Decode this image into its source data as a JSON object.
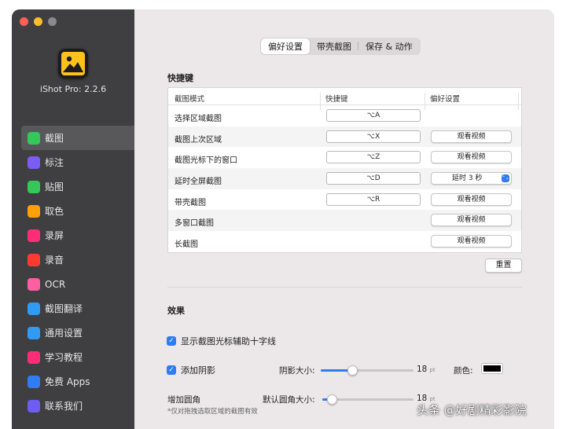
{
  "app": {
    "version": "iShot Pro: 2.2.6"
  },
  "sidebar": {
    "items": [
      {
        "label": "截图",
        "icon": "screenshot-icon",
        "color": "#34c759",
        "active": true
      },
      {
        "label": "标注",
        "icon": "cursor-icon",
        "color": "#7b5cf5"
      },
      {
        "label": "贴图",
        "icon": "pin-icon",
        "color": "#34c759"
      },
      {
        "label": "取色",
        "icon": "eyedropper-icon",
        "color": "#ff9f0a"
      },
      {
        "label": "录屏",
        "icon": "screen-record-icon",
        "color": "#ff2d78"
      },
      {
        "label": "录音",
        "icon": "microphone-icon",
        "color": "#ff3b30"
      },
      {
        "label": "OCR",
        "icon": "ocr-icon",
        "color": "#ff5fa2"
      },
      {
        "label": "截图翻译",
        "icon": "translate-icon",
        "color": "#2f9bf5"
      },
      {
        "label": "通用设置",
        "icon": "gear-icon",
        "color": "#2f9bf5"
      },
      {
        "label": "学习教程",
        "icon": "play-icon",
        "color": "#ff2d78"
      },
      {
        "label": "免费 Apps",
        "icon": "app-store-icon",
        "color": "#2f7cf6"
      },
      {
        "label": "联系我们",
        "icon": "contact-icon",
        "color": "#6e5cf5"
      }
    ]
  },
  "tabs": [
    {
      "label": "偏好设置",
      "active": true
    },
    {
      "label": "带壳截图"
    },
    {
      "label": "保存 & 动作"
    }
  ],
  "shortcuts": {
    "title": "快捷键",
    "headers": [
      "截图模式",
      "快捷键",
      "偏好设置"
    ],
    "rows": [
      {
        "mode": "选择区域截图",
        "key": "⌥A",
        "pref": ""
      },
      {
        "mode": "截图上次区域",
        "key": "⌥X",
        "pref": "观看视频"
      },
      {
        "mode": "截图光标下的窗口",
        "key": "⌥Z",
        "pref": "观看视频"
      },
      {
        "mode": "延时全屏截图",
        "key": "⌥D",
        "pref": "延时 3 秒",
        "select": true
      },
      {
        "mode": "带壳截图",
        "key": "⌥R",
        "pref": "观看视频"
      },
      {
        "mode": "多窗口截图",
        "key": "",
        "pref": "观看视频"
      },
      {
        "mode": "长截图",
        "key": "",
        "pref": "观看视频"
      }
    ],
    "reset_label": "重置"
  },
  "effects": {
    "title": "效果",
    "crosshair_label": "显示截图光标辅助十字线",
    "shadow_label": "添加阴影",
    "shadow_size_label": "阴影大小:",
    "shadow_size_value": "18",
    "shadow_size_fraction": 0.34,
    "unit": "pt",
    "color_label": "颜色:",
    "shadow_color": "#000000",
    "corner_label": "增加圆角",
    "corner_size_label": "默认圆角大小:",
    "corner_size_value": "18",
    "corner_size_fraction": 0.1,
    "corner_note": "*仅对拖拽选取区域的截图有效"
  },
  "watermark": "头条 @好剧精彩影院",
  "colors": {
    "accent": "#2f7cf6",
    "sidebar_bg": "#3f3f41"
  }
}
